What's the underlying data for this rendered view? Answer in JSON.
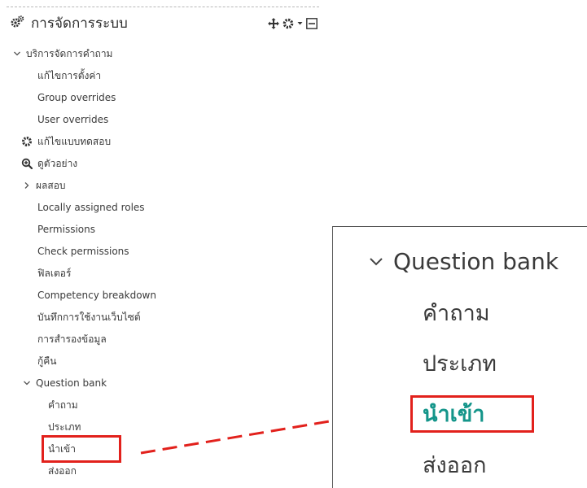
{
  "block": {
    "title": "การจัดการระบบ",
    "title_icon": "gears-icon",
    "controls": [
      "move-icon",
      "gear-icon",
      "caret-down-icon",
      "collapse-icon"
    ]
  },
  "tree": {
    "quiz_admin": {
      "label": "บริการจัดการคำถาม",
      "state": "expanded"
    },
    "edit_settings": "แก้ไขการตั้งค่า",
    "group_overrides": "Group overrides",
    "user_overrides": "User overrides",
    "edit_quiz": {
      "label": "แก้ไขแบบทดสอบ",
      "icon": "gear-icon"
    },
    "preview": {
      "label": "ดูตัวอย่าง",
      "icon": "zoom-in-icon"
    },
    "results": {
      "label": "ผลสอบ",
      "state": "collapsed"
    },
    "locally_assigned_roles": "Locally assigned roles",
    "permissions": "Permissions",
    "check_permissions": "Check permissions",
    "filters": "ฟิลเตอร์",
    "competency_breakdown": "Competency breakdown",
    "logs": "บันทึกการใช้งานเว็บไซต์",
    "backup": "การสำรองข้อมูล",
    "restore": "กู้คืน",
    "question_bank": {
      "label": "Question bank",
      "state": "expanded"
    },
    "questions": "คำถาม",
    "categories": "ประเภท",
    "import": "นำเข้า",
    "export": "ส่งออก"
  },
  "highlight": {
    "item": "import",
    "color": "#e2211c"
  },
  "zoom": {
    "header": "Question bank",
    "items": [
      "คำถาม",
      "ประเภท",
      "นำเข้า",
      "ส่งออก"
    ],
    "active_index": 2,
    "active_color": "#14958a"
  }
}
